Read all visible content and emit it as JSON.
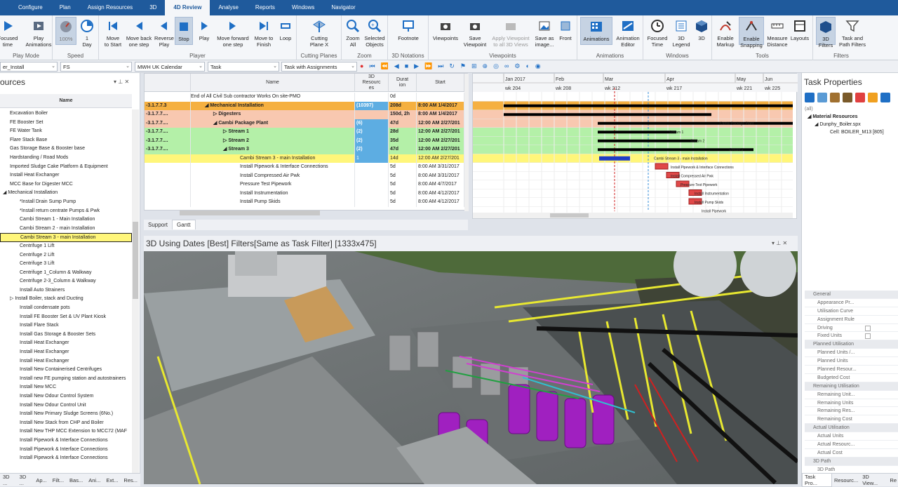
{
  "menu": [
    "Configure",
    "Plan",
    "Assign Resources",
    "3D",
    "4D Review",
    "Analyse",
    "Reports",
    "Windows",
    "Navigator"
  ],
  "menu_active": "4D Review",
  "ribbon": {
    "groups": {
      "play_mode": "Play Mode",
      "speed": "Speed",
      "player": "Player",
      "cutting_planes": "Cutting Planes",
      "zoom": "Zoom",
      "notations": "3D Notations",
      "viewpoints": "Viewpoints",
      "animations": "Animations",
      "windows": "Windows",
      "tools": "Tools",
      "filters": "Filters"
    },
    "buttons": {
      "focused_time": "Focused\ntime",
      "play_animations": "Play\nAnimations",
      "speed_pct": "100%",
      "speed_day": "1\nDay",
      "move_to_start": "Move\nto Start",
      "move_back": "Move back\none step",
      "reverse_play": "Reverse\nPlay",
      "stop": "Stop",
      "play": "Play",
      "move_forward": "Move forward\none step",
      "move_to_finish": "Move to\nFinish",
      "loop": "Loop",
      "cutting_plane": "Cutting\nPlane X",
      "zoom_all": "Zoom\nAll",
      "selected_objects": "Selected\nObjects",
      "footnote": "Footnote",
      "viewpoints": "Viewpoints",
      "save_viewpoint": "Save\nViewpoint",
      "apply_viewpoint": "Apply Viewpoint\nto all 3D Views",
      "save_as_image": "Save as\nimage...",
      "front": "Front",
      "animations": "Animations",
      "animation_editor": "Animation\nEditor",
      "focused_time2": "Focused\nTime",
      "legend_3d": "3D\nLegend",
      "view_3d": "3D",
      "enable_markup": "Enable\nMarkup",
      "enable_snapping": "Enable\nSnapping",
      "measure_distance": "Measure\nDistance",
      "layouts": "Layouts",
      "filters_3d": "3D\nFilters",
      "task_path_filters": "Task and\nPath Filters"
    }
  },
  "filterbar": {
    "c1": "er_Install",
    "c2": "FS",
    "c3": "MWH UK Calendar",
    "c4": "Task",
    "c5": "Task with Assignments"
  },
  "left_panel": {
    "title": "ources",
    "header": "Name",
    "rows": [
      {
        "t": "Excavation Boiler",
        "i": 1
      },
      {
        "t": "FE Booster Set",
        "i": 1
      },
      {
        "t": "FE Water Tank",
        "i": 1
      },
      {
        "t": "Flare Stack Base",
        "i": 1
      },
      {
        "t": "Gas Storage Base & Booster base",
        "i": 1
      },
      {
        "t": "Hardstanding / Road Mods",
        "i": 1
      },
      {
        "t": "Imported Sludge Cake Platform & Equipment",
        "i": 1
      },
      {
        "t": "Install Heat Exchanger",
        "i": 1
      },
      {
        "t": "MCC Base for Digester MCC",
        "i": 1
      },
      {
        "t": "◢ Mechanical  Installation",
        "i": 0
      },
      {
        "t": "*Install Drain Sump Pump",
        "i": 2
      },
      {
        "t": "*Install return centrate Pumps & Pwk",
        "i": 2
      },
      {
        "t": "Cambi Stream 1 - Main Installation",
        "i": 2
      },
      {
        "t": "Cambi Stream 2 - main Installation",
        "i": 2
      },
      {
        "t": "Cambi Stream 3 - main Installation",
        "i": 2,
        "sel": true
      },
      {
        "t": "Centrifuge 1 Lift",
        "i": 2
      },
      {
        "t": "Centrifuge 2 Lift",
        "i": 2
      },
      {
        "t": "Centrifuge 3 Lift",
        "i": 2
      },
      {
        "t": "Centrifuge 1_Column & Walkway",
        "i": 2
      },
      {
        "t": "Centrifuge 2-3_Column & Walkway",
        "i": 2
      },
      {
        "t": "Install Auto Strainers",
        "i": 2
      },
      {
        "t": "▷ Install Boiler, stack and Ducting",
        "i": 1
      },
      {
        "t": "Install condensate pots",
        "i": 2
      },
      {
        "t": "Install FE Booster Set & UV Plant Kiosk",
        "i": 2
      },
      {
        "t": "Install Flare Stack",
        "i": 2
      },
      {
        "t": "Install Gas Storage & Booster Sets",
        "i": 2
      },
      {
        "t": "Install Heat Exchanger",
        "i": 2
      },
      {
        "t": "Install Heat Exchanger",
        "i": 2
      },
      {
        "t": "Install Heat Exchanger",
        "i": 2
      },
      {
        "t": "Install New Containerised Centrifuges",
        "i": 2
      },
      {
        "t": "Install new FE pumping station and autostrainers",
        "i": 2
      },
      {
        "t": "Install New MCC",
        "i": 2
      },
      {
        "t": "Install New Odour Control System",
        "i": 2
      },
      {
        "t": "Install New Odour Control Unit",
        "i": 2
      },
      {
        "t": "Install New Primary Sludge Screens (6No.)",
        "i": 2
      },
      {
        "t": "Install New Stack from CHP  and Boiler",
        "i": 2
      },
      {
        "t": "Install New THP MCC Extension to MCC72 (MAF",
        "i": 2
      },
      {
        "t": "Install Pipework & Interface Connections",
        "i": 2
      },
      {
        "t": "Install Pipework & Interface Connections",
        "i": 2
      },
      {
        "t": "Install Pipework & Interface Connections",
        "i": 2
      }
    ],
    "bottom_tabs": [
      "3D ...",
      "3D ...",
      "Ap...",
      "Filt...",
      "Bas...",
      "Ani...",
      "Ext...",
      "Res..."
    ]
  },
  "task_grid": {
    "headers": {
      "name": "Name",
      "res": "3D\nResourc\nes",
      "dur": "Durat\nion",
      "start": "Start"
    },
    "rows": [
      {
        "id": "",
        "name": "End  of  All Civil Sub contractor  Works On site-PMO",
        "res": "",
        "dur": "0d",
        "start": "",
        "bg": "#ffffff",
        "bold": false,
        "ind": 60
      },
      {
        "id": "-3.1.7.7.3",
        "name": "◢ Mechanical  Installation",
        "res": "(10397)",
        "dur": "208d",
        "start": "8:00 AM 1/4/2017",
        "bg": "#f5b041",
        "bold": true,
        "ind": 86
      },
      {
        "id": "-3.1.7.7....",
        "name": "▷ Digesters",
        "res": "",
        "dur": "150d, 2h",
        "start": "8:00 AM 1/4/2017",
        "bg": "#f8c8b0",
        "bold": true,
        "ind": 98
      },
      {
        "id": "-3.1.7.7....",
        "name": "◢ Cambi Package Plant",
        "res": "(6)",
        "dur": "47d",
        "start": "12:00 AM 2/27/201",
        "bg": "#f8c8b0",
        "bold": true,
        "ind": 98
      },
      {
        "id": "-3.1.7.7....",
        "name": "▷ Stream 1",
        "res": "(2)",
        "dur": "28d",
        "start": "12:00 AM 2/27/201",
        "bg": "#b4f0a8",
        "bold": true,
        "ind": 112
      },
      {
        "id": "-3.1.7.7....",
        "name": "▷ Stream 2",
        "res": "(2)",
        "dur": "35d",
        "start": "12:00 AM 2/27/201",
        "bg": "#b4f0a8",
        "bold": true,
        "ind": 112
      },
      {
        "id": "-3.1.7.7....",
        "name": "◢ Stream 3",
        "res": "(2)",
        "dur": "47d",
        "start": "12:00 AM 2/27/201",
        "bg": "#b4f0a8",
        "bold": true,
        "ind": 112
      },
      {
        "id": "",
        "name": "Cambi Stream 3 - main Installation",
        "res": "1",
        "dur": "14d",
        "start": "12:00 AM 2/27/201",
        "bg": "#fff67a",
        "bold": false,
        "ind": 136
      },
      {
        "id": "",
        "name": "Install Pipework & Interface Connections",
        "res": "",
        "dur": "5d",
        "start": "8:00 AM 3/31/2017",
        "bg": "#ffffff",
        "bold": false,
        "ind": 136
      },
      {
        "id": "",
        "name": "Install Compressed Air Pwk",
        "res": "",
        "dur": "5d",
        "start": "8:00 AM 3/31/2017",
        "bg": "#ffffff",
        "bold": false,
        "ind": 136
      },
      {
        "id": "",
        "name": "Pressure Test Pipework",
        "res": "",
        "dur": "5d",
        "start": "8:00 AM 4/7/2017",
        "bg": "#ffffff",
        "bold": false,
        "ind": 136
      },
      {
        "id": "",
        "name": "Install Instrumentation",
        "res": "",
        "dur": "5d",
        "start": "8:00 AM 4/12/2017",
        "bg": "#ffffff",
        "bold": false,
        "ind": 136
      },
      {
        "id": "",
        "name": "Install Pump Skids",
        "res": "",
        "dur": "5d",
        "start": "8:00 AM 4/12/2017",
        "bg": "#ffffff",
        "bold": false,
        "ind": 136
      }
    ]
  },
  "gantt": {
    "months": [
      "Jan 2017",
      "Feb",
      "Mar",
      "Apr",
      "May",
      "Jun"
    ],
    "weeks": [
      "wk 204",
      "wk 208",
      "wk 212",
      "wk 217",
      "wk 221",
      "wk 225"
    ],
    "bar_labels": [
      "Cambi Package Plant",
      "Stream 1",
      "Stream 2",
      "Stream 3",
      "Cambi Stream 3 - main Installation",
      "Install Pipework & Interface Connections",
      "Install Compressed Air Pwk",
      "Pressure Test Pipework",
      "Install Instrumentation",
      "Install Pump Skids",
      "Install Pipework"
    ]
  },
  "gantt_tabs": [
    "Support",
    "Gantt"
  ],
  "view3d": {
    "title": "3D Using Dates [Best] Filters[Same as Task Filter] [1333x475]"
  },
  "right_panel": {
    "title": "Task Properties",
    "tree": {
      "all": "(all)",
      "material": "Material Resources",
      "file": "Dunphy_Boiler.spx",
      "cell": "Cell: BOILER_M13 [805]"
    },
    "props": [
      {
        "t": "General",
        "cat": true
      },
      {
        "t": "Appearance Pr..."
      },
      {
        "t": "Utilisation Curve"
      },
      {
        "t": "Assignment Rule"
      },
      {
        "t": "Driving",
        "chk": true
      },
      {
        "t": "Fixed Units",
        "chk": true
      },
      {
        "t": "Planned Utilisation",
        "cat": true
      },
      {
        "t": "Planned Units /..."
      },
      {
        "t": "Planned Units"
      },
      {
        "t": "Planned Resour..."
      },
      {
        "t": "Budgeted Cost"
      },
      {
        "t": "Remaining Utilisation",
        "cat": true
      },
      {
        "t": "Remaining Unit..."
      },
      {
        "t": "Remaining Units"
      },
      {
        "t": "Remaining Res..."
      },
      {
        "t": "Remaining Cost"
      },
      {
        "t": "Actual Utilisation",
        "cat": true
      },
      {
        "t": "Actual Units"
      },
      {
        "t": "Actual Resourc..."
      },
      {
        "t": "Actual Cost"
      },
      {
        "t": "3D Path",
        "cat": true
      },
      {
        "t": "3D Path"
      }
    ],
    "bottom_tabs": [
      "Task Pro...",
      "Resourc...",
      "3D View...",
      "Re"
    ]
  }
}
